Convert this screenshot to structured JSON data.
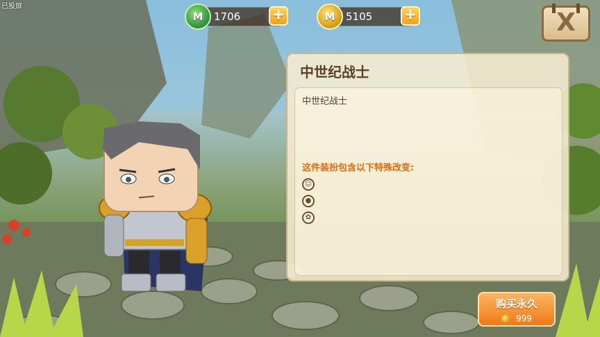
{
  "overlay": {
    "corner_text": "已投屏"
  },
  "currency": {
    "mini_beans": {
      "icon": "mini-bean-coin-icon",
      "amount": "1706",
      "add_label": "+"
    },
    "gold_coins": {
      "icon": "gold-coin-icon",
      "amount": "5105",
      "add_label": "+"
    }
  },
  "close_label": "X",
  "panel": {
    "title": "中世纪战士",
    "item_name": "中世纪战士",
    "effects_heading": "这件装扮包含以下特殊改变:",
    "effect_icons": [
      "person-face-icon",
      "person-icon",
      "paw-icon"
    ]
  },
  "buy": {
    "label": "购买永久",
    "price": "999",
    "price_icon": "gold-coin-icon"
  },
  "colors": {
    "accent_orange": "#ee7a17",
    "panel_bg": "#f6ecd2",
    "title_brown": "#5a4128",
    "heading_orange": "#e06a14"
  }
}
